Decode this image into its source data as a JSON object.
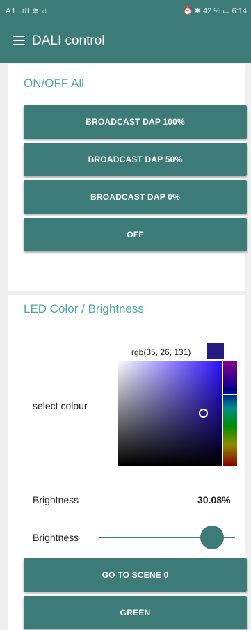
{
  "status_bar": {
    "left": "A1 .ıll ≋ ಠ",
    "right": "⏰ ✱ 42 % ▭ 6:14"
  },
  "app_bar": {
    "title": "DALI control",
    "menu_icon": "hamburger-menu-icon"
  },
  "on_off_section": {
    "title": "ON/OFF All",
    "buttons": [
      "BROADCAST DAP 100%",
      "BROADCAST DAP 50%",
      "BROADCAST DAP 0%",
      "OFF"
    ]
  },
  "led_section": {
    "title": "LED Color / Brightness",
    "colour_label": "select colour",
    "rgb_text": "rgb(35, 26, 131)",
    "selected_color": "#231a83",
    "brightness_label": "Brightness",
    "brightness_value": "30.08%",
    "slider_label": "Brightness",
    "slider_fraction": 0.83,
    "buttons": [
      "GO TO SCENE 0",
      "GREEN"
    ]
  },
  "colors": {
    "primary": "#3d7b78",
    "accent_text": "#4ea7a4"
  }
}
